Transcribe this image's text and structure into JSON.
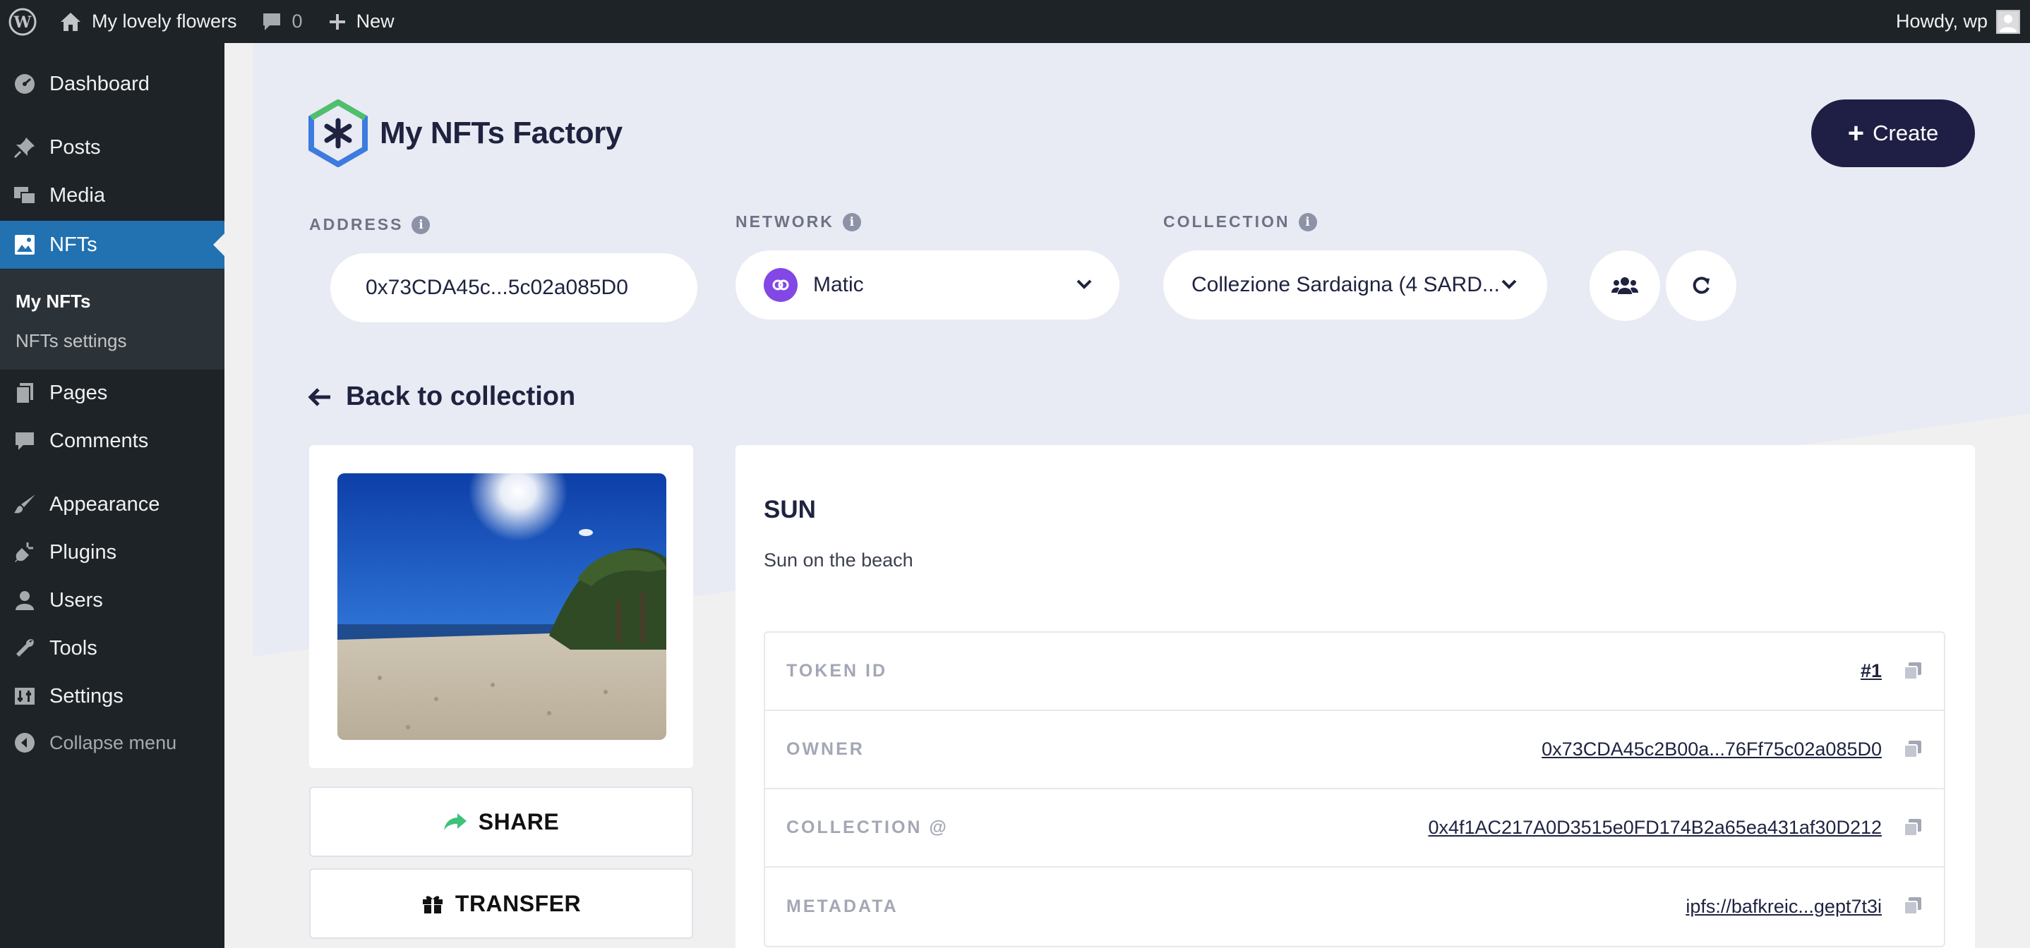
{
  "adminbar": {
    "site_name": "My lovely flowers",
    "comments_count": "0",
    "new_label": "New",
    "greeting": "Howdy, wp"
  },
  "sidebar": {
    "items": [
      {
        "label": "Dashboard",
        "icon": "dashboard-icon"
      },
      {
        "label": "Posts",
        "icon": "pin-icon"
      },
      {
        "label": "Media",
        "icon": "media-icon"
      },
      {
        "label": "NFTs",
        "icon": "image-icon",
        "current": true
      },
      {
        "label": "Pages",
        "icon": "pages-icon"
      },
      {
        "label": "Comments",
        "icon": "comment-icon"
      },
      {
        "label": "Appearance",
        "icon": "brush-icon"
      },
      {
        "label": "Plugins",
        "icon": "plugin-icon"
      },
      {
        "label": "Users",
        "icon": "user-icon"
      },
      {
        "label": "Tools",
        "icon": "wrench-icon"
      },
      {
        "label": "Settings",
        "icon": "settings-icon"
      }
    ],
    "submenu": [
      "My NFTs",
      "NFTs settings"
    ],
    "collapse_label": "Collapse menu"
  },
  "app": {
    "title": "My NFTs Factory",
    "create_label": "Create"
  },
  "filters": {
    "address_label": "ADDRESS",
    "address_value": "0x73CDA45c...5c02a085D0",
    "network_label": "NETWORK",
    "network_value": "Matic",
    "collection_label": "COLLECTION",
    "collection_value": "Collezione Sardaigna (4 SARD..."
  },
  "back_label": "Back to collection",
  "actions": {
    "share": "SHARE",
    "transfer": "TRANSFER"
  },
  "nft": {
    "name": "SUN",
    "description": "Sun on the beach",
    "properties": [
      {
        "label": "TOKEN ID",
        "value": "#1"
      },
      {
        "label": "OWNER",
        "value": "0x73CDA45c2B00a...76Ff75c02a085D0"
      },
      {
        "label": "COLLECTION @",
        "value": "0x4f1AC217A0D3515e0FD174B2a65ea431af30D212"
      },
      {
        "label": "METADATA",
        "value": "ipfs://bafkreic...gept7t3i"
      }
    ]
  },
  "colors": {
    "wp_dark": "#1d2327",
    "wp_blue": "#2271b1",
    "hero_bg": "#e8ebf3",
    "create_btn": "#1f1f45",
    "matic": "#8247e5",
    "share_arrow": "#3ec27a"
  }
}
